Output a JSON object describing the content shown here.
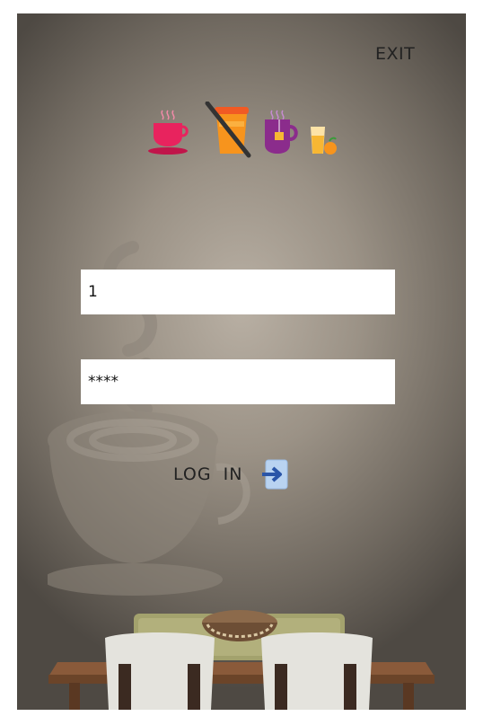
{
  "header": {
    "exit_label": "EXIT"
  },
  "logo": {
    "icons": [
      "hot-cup-icon",
      "no-drink-icon",
      "tea-mug-icon",
      "juice-icon"
    ],
    "colors": {
      "cup": "#e8235e",
      "orange": "#f7941d",
      "purple": "#8b2c8c",
      "juice": "#f7b733"
    }
  },
  "form": {
    "username_value": "1",
    "password_value": "****"
  },
  "login": {
    "label": "LOG IN",
    "icon": "login-arrow-icon",
    "icon_color": "#2a55a8"
  }
}
